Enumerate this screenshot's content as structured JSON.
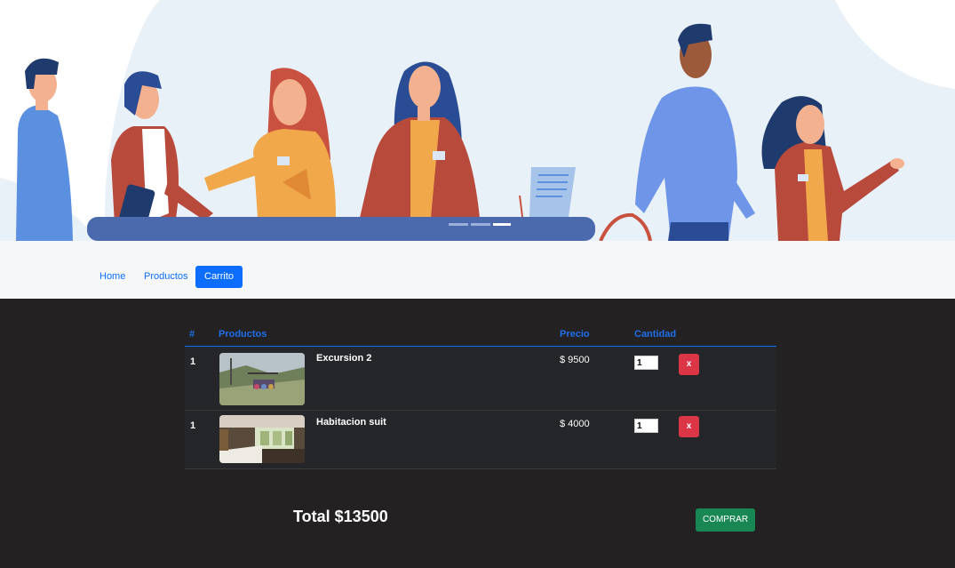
{
  "nav": {
    "items": [
      {
        "label": "Home"
      },
      {
        "label": "Productos"
      },
      {
        "label": "Carrito"
      }
    ]
  },
  "table": {
    "headers": {
      "idx": "#",
      "product": "Productos",
      "price": "Precio",
      "qty": "Cantidad"
    },
    "rows": [
      {
        "idx": "1",
        "name": "Excursion 2",
        "price": "$ 9500",
        "qty": "1",
        "delete": "x"
      },
      {
        "idx": "1",
        "name": "Habitacion suit",
        "price": "$ 4000",
        "qty": "1",
        "delete": "x"
      }
    ]
  },
  "summary": {
    "total": "Total $13500",
    "buy_label": "COMPRAR"
  },
  "colors": {
    "primary": "#0d6efd",
    "danger": "#dc3545",
    "success": "#198754",
    "dark_bg": "#232122"
  }
}
